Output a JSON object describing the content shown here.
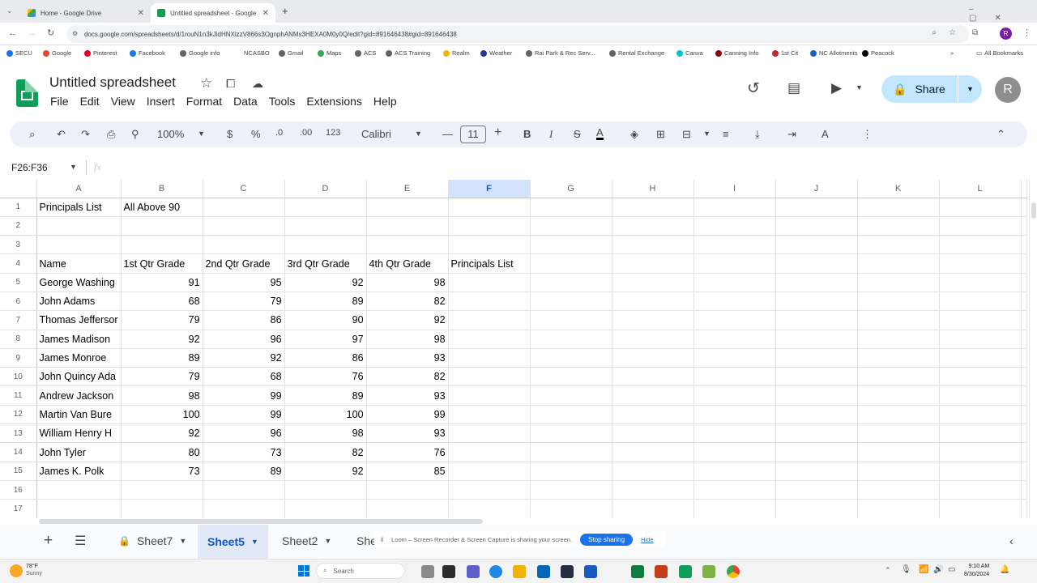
{
  "browser": {
    "tabs": [
      {
        "title": "Home - Google Drive",
        "active": false
      },
      {
        "title": "Untitled spreadsheet - Google",
        "active": true
      }
    ],
    "url": "docs.google.com/spreadsheets/d/1rouN1n3kJidHNXlzzV866s3OgnphANMs3HEXA0M0y0Q/edit?gid=891646438#gid=891646438",
    "bookmarks": [
      "SECU",
      "Google",
      "Pinterest",
      "Facebook",
      "Google info",
      "NCASBO",
      "Gmail",
      "Maps",
      "ACS",
      "ACS Training",
      "Realm",
      "Weather",
      "Rai Park & Rec Serv...",
      "Rental Exchange",
      "Canva",
      "Canning Info",
      "1st Cit",
      "NC Allotments",
      "Peacock"
    ],
    "all_bookmarks": "All Bookmarks",
    "profile_initial": "R"
  },
  "doc": {
    "title": "Untitled spreadsheet",
    "menus": [
      "File",
      "Edit",
      "View",
      "Insert",
      "Format",
      "Data",
      "Tools",
      "Extensions",
      "Help"
    ],
    "share_label": "Share",
    "avatar_initial": "R"
  },
  "toolbar": {
    "zoom": "100%",
    "currency": "$",
    "percent": "%",
    "dec_dec": ".0",
    "dec_inc": ".00",
    "format_123": "123",
    "font": "Calibri",
    "font_size": "11",
    "bold": "B",
    "italic": "I"
  },
  "formula_bar": {
    "name_box": "F26:F36",
    "fx": "fx",
    "content": ""
  },
  "grid": {
    "columns": [
      "A",
      "B",
      "C",
      "D",
      "E",
      "F",
      "G",
      "H",
      "I",
      "J",
      "K",
      "L"
    ],
    "selected_column": "F",
    "row_numbers": [
      "1",
      "2",
      "3",
      "4",
      "5",
      "6",
      "7",
      "8",
      "9",
      "10",
      "11",
      "12",
      "13",
      "14",
      "15",
      "16",
      "17"
    ],
    "rows": [
      [
        "Principals List",
        "All Above 90",
        "",
        "",
        "",
        ""
      ],
      [
        "",
        "",
        "",
        "",
        "",
        ""
      ],
      [
        "",
        "",
        "",
        "",
        "",
        ""
      ],
      [
        "Name",
        "1st Qtr Grade",
        "2nd Qtr Grade",
        "3rd Qtr Grade",
        "4th Qtr Grade",
        "Principals List"
      ],
      [
        "George Washing",
        "91",
        "95",
        "92",
        "98",
        ""
      ],
      [
        "John Adams",
        "68",
        "79",
        "89",
        "82",
        ""
      ],
      [
        "Thomas Jeffersor",
        "79",
        "86",
        "90",
        "92",
        ""
      ],
      [
        "James Madison",
        "92",
        "96",
        "97",
        "98",
        ""
      ],
      [
        "James Monroe",
        "89",
        "92",
        "86",
        "93",
        ""
      ],
      [
        "John Quincy Ada",
        "79",
        "68",
        "76",
        "82",
        ""
      ],
      [
        "Andrew Jackson",
        "98",
        "99",
        "89",
        "93",
        ""
      ],
      [
        "Martin Van Bure",
        "100",
        "99",
        "100",
        "99",
        ""
      ],
      [
        "William Henry H",
        "92",
        "96",
        "98",
        "93",
        ""
      ],
      [
        "John Tyler",
        "80",
        "73",
        "82",
        "76",
        ""
      ],
      [
        "James K. Polk",
        "73",
        "89",
        "92",
        "85",
        ""
      ],
      [
        "",
        "",
        "",
        "",
        "",
        ""
      ],
      [
        "",
        "",
        "",
        "",
        "",
        ""
      ]
    ]
  },
  "sheets": {
    "add": "+",
    "tabs": [
      {
        "name": "Sheet7",
        "locked": true,
        "active": false
      },
      {
        "name": "Sheet5",
        "locked": false,
        "active": true
      },
      {
        "name": "Sheet2",
        "locked": false,
        "active": false
      },
      {
        "name": "She",
        "locked": false,
        "active": false
      }
    ]
  },
  "loom": {
    "message": "Loom – Screen Recorder & Screen Capture is sharing your screen.",
    "stop": "Stop sharing",
    "hide": "Hide"
  },
  "taskbar": {
    "weather_temp": "78°F",
    "weather_desc": "Sunny",
    "search": "Search",
    "time": "9:10 AM",
    "date": "8/30/2024"
  },
  "colors": {
    "sheets_green": "#0f9d58",
    "share_bg": "#c2e7ff",
    "active_sheet": "#0b57d0",
    "toolbar_bg": "#edf2fa"
  }
}
